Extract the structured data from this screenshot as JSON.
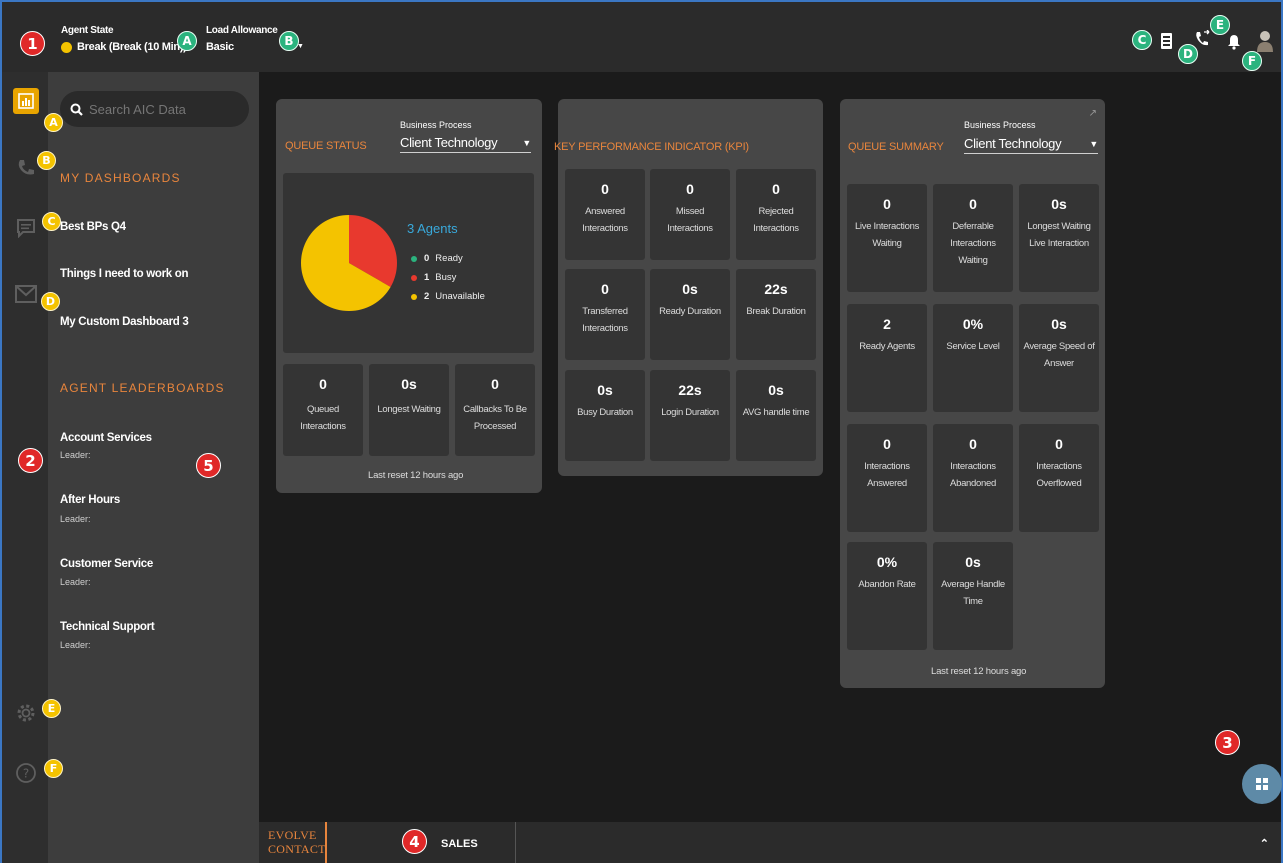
{
  "topbar": {
    "agent_state_label": "Agent State",
    "agent_state_value": "Break (Break (10 Min))",
    "agent_state_color": "#f4c300",
    "load_allowance_label": "Load Allowance",
    "load_allowance_value": "Basic",
    "icons": [
      "contact-card-icon",
      "transfer-call-icon",
      "bell-icon",
      "user-avatar"
    ]
  },
  "badges": {
    "red": [
      "1",
      "2",
      "3",
      "4",
      "5"
    ],
    "green": [
      "A",
      "B",
      "C",
      "D",
      "E",
      "F"
    ],
    "yellow": [
      "A",
      "B",
      "C",
      "D",
      "E",
      "F"
    ]
  },
  "rail": {
    "items": [
      "dashboard-icon",
      "phone-icon",
      "chat-icon",
      "mail-icon",
      "settings-icon",
      "help-icon"
    ]
  },
  "sidebar": {
    "search_placeholder": "Search AIC Data",
    "my_dashboards_title": "MY DASHBOARDS",
    "dashboards": [
      "Best BPs Q4",
      "Things I need to work on",
      "My Custom Dashboard 3"
    ],
    "leaderboards_title": "AGENT LEADERBOARDS",
    "leaderboards": [
      {
        "name": "Account Services",
        "leader": "Leader:"
      },
      {
        "name": "After Hours",
        "leader": "Leader:"
      },
      {
        "name": "Customer Service",
        "leader": "Leader:"
      },
      {
        "name": "Technical Support",
        "leader": "Leader:"
      }
    ]
  },
  "queue_status": {
    "title": "QUEUE STATUS",
    "bp_label": "Business Process",
    "bp_value": "Client Technology",
    "agents_label": "3 Agents",
    "legend": [
      {
        "count": "0",
        "label": "Ready",
        "color": "#2bb37e"
      },
      {
        "count": "1",
        "label": "Busy",
        "color": "#e8392e"
      },
      {
        "count": "2",
        "label": "Unavailable",
        "color": "#f4c300"
      }
    ],
    "tiles": [
      {
        "value": "0",
        "label": "Queued Interactions"
      },
      {
        "value": "0s",
        "label": "Longest Waiting"
      },
      {
        "value": "0",
        "label": "Callbacks To Be Processed"
      }
    ],
    "footnote": "Last reset 12 hours ago"
  },
  "kpi": {
    "title": "KEY PERFORMANCE INDICATOR (KPI)",
    "tiles": [
      {
        "value": "0",
        "label": "Answered Interactions"
      },
      {
        "value": "0",
        "label": "Missed Interactions"
      },
      {
        "value": "0",
        "label": "Rejected Interactions"
      },
      {
        "value": "0",
        "label": "Transferred Interactions"
      },
      {
        "value": "0s",
        "label": "Ready Duration"
      },
      {
        "value": "22s",
        "label": "Break Duration"
      },
      {
        "value": "0s",
        "label": "Busy Duration"
      },
      {
        "value": "22s",
        "label": "Login Duration"
      },
      {
        "value": "0s",
        "label": "AVG handle time"
      }
    ]
  },
  "queue_summary": {
    "title": "QUEUE SUMMARY",
    "bp_label": "Business Process",
    "bp_value": "Client Technology",
    "tiles": [
      {
        "value": "0",
        "label": "Live Interactions Waiting"
      },
      {
        "value": "0",
        "label": "Deferrable Interactions Waiting"
      },
      {
        "value": "0s",
        "label": "Longest Waiting Live Interaction"
      },
      {
        "value": "2",
        "label": "Ready Agents"
      },
      {
        "value": "0%",
        "label": "Service Level"
      },
      {
        "value": "0s",
        "label": "Average Speed of Answer"
      },
      {
        "value": "0",
        "label": "Interactions Answered"
      },
      {
        "value": "0",
        "label": "Interactions Abandoned"
      },
      {
        "value": "0",
        "label": "Interactions Overflowed"
      },
      {
        "value": "0%",
        "label": "Abandon Rate"
      },
      {
        "value": "0s",
        "label": "Average Handle Time"
      }
    ],
    "footnote": "Last reset 12 hours ago"
  },
  "bottombar": {
    "logo_line1": "EVOLVE",
    "logo_line2": "CONTACT",
    "tab_label": "SALES"
  }
}
